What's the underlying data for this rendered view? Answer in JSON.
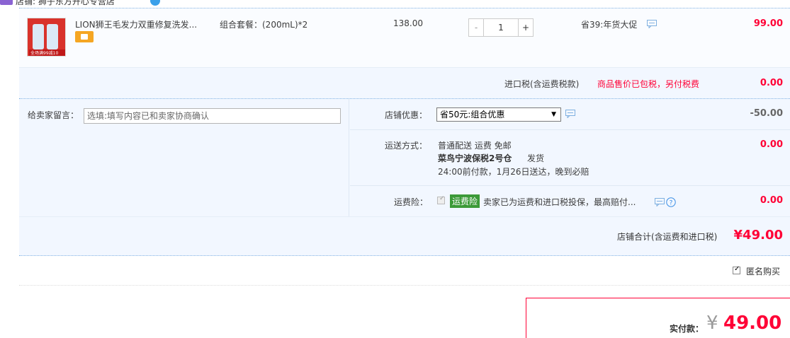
{
  "header": {
    "shop_title": "店铺: 狮子东方开心专营店"
  },
  "product": {
    "name": "LION狮王毛发力双重修复洗发...",
    "sku": "组合套餐：(200mL)*2",
    "unit_price": "138.00",
    "qty": "1",
    "qty_minus": "-",
    "qty_plus": "+",
    "discount": "省39:年货大促",
    "subtotal": "99.00",
    "thumb_promo": "全场满99减10"
  },
  "import_tax": {
    "label": "进口税(含运费税款)",
    "note": "商品售价已包税，另付税费",
    "value": "0.00"
  },
  "message": {
    "label": "给卖家留言：",
    "placeholder": "选填:填写内容已和卖家协商确认"
  },
  "shop_discount": {
    "label": "店铺优惠：",
    "selected": "省50元:组合优惠",
    "value": "-50.00"
  },
  "shipping": {
    "label": "运送方式：",
    "method": "普通配送 运费 免邮",
    "warehouse": "菜鸟宁波保税2号仓",
    "dispatch": "发货",
    "eta": "24:00前付款，1月26日送达，晚到必赔",
    "value": "0.00"
  },
  "insurance": {
    "label": "运费险：",
    "tag": "运费险",
    "desc": "卖家已为运费和进口税投保，最高赔付...",
    "value": "0.00"
  },
  "shop_total": {
    "label": "店铺合计(含运费和进口税)",
    "value": "¥49.00"
  },
  "anonymous": {
    "label": "匿名购买",
    "checked": true
  },
  "payment": {
    "label": "实付款：",
    "currency": "¥",
    "value": "49.00"
  },
  "colors": {
    "accent_red": "#ff0036",
    "row_bg": "#f2f7ff",
    "dash_blue": "#80b2e3",
    "tag_green": "#3c9a38"
  }
}
